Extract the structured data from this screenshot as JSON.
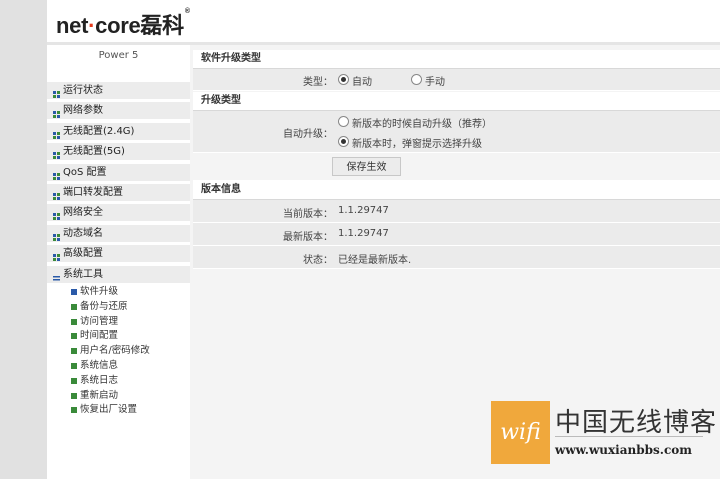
{
  "brand": {
    "logo_prefix": "net",
    "logo_dot": "·",
    "logo_suffix": "core",
    "logo_cn": "磊科",
    "reg": "®"
  },
  "model": "Power 5",
  "menu": [
    {
      "label": "运行状态",
      "active": false
    },
    {
      "label": "网络参数",
      "active": false
    },
    {
      "label": "无线配置(2.4G)",
      "active": false
    },
    {
      "label": "无线配置(5G)",
      "active": false
    },
    {
      "label": "QoS 配置",
      "active": false
    },
    {
      "label": "端口转发配置",
      "active": false
    },
    {
      "label": "网络安全",
      "active": false
    },
    {
      "label": "动态域名",
      "active": false
    },
    {
      "label": "高级配置",
      "active": false
    },
    {
      "label": "系统工具",
      "active": true
    }
  ],
  "submenu": [
    {
      "label": "软件升级",
      "active": true
    },
    {
      "label": "备份与还原",
      "active": false
    },
    {
      "label": "访问管理",
      "active": false
    },
    {
      "label": "时间配置",
      "active": false
    },
    {
      "label": "用户名/密码修改",
      "active": false
    },
    {
      "label": "系统信息",
      "active": false
    },
    {
      "label": "系统日志",
      "active": false
    },
    {
      "label": "重新启动",
      "active": false
    },
    {
      "label": "恢复出厂设置",
      "active": false
    }
  ],
  "upgrade_type_section": {
    "title": "软件升级类型",
    "type_label": "类型：",
    "auto_label": "自动",
    "manual_label": "手动",
    "selected": "auto"
  },
  "upgrade_mode_section": {
    "title": "升级类型",
    "auto_upgrade_label": "自动升级：",
    "option_auto": "新版本的时候自动升级（推荐）",
    "option_prompt": "新版本时，弹窗提示选择升级",
    "selected": "prompt",
    "save_label": "保存生效"
  },
  "version_section": {
    "title": "版本信息",
    "current_label": "当前版本：",
    "current_value": "1.1.29747",
    "latest_label": "最新版本：",
    "latest_value": "1.1.29747",
    "status_label": "状态：",
    "status_value": "已经是最新版本."
  },
  "watermark": {
    "box_text": "wifi",
    "title": "中国无线博客",
    "url": "www.wuxianbbs.com"
  },
  "colors": {
    "menu_icon": "#3a8a3a",
    "icon_alt": "#2a5aa8",
    "active_sub_icon": "#2a5aa8",
    "accent_orange": "#f0a83c"
  }
}
